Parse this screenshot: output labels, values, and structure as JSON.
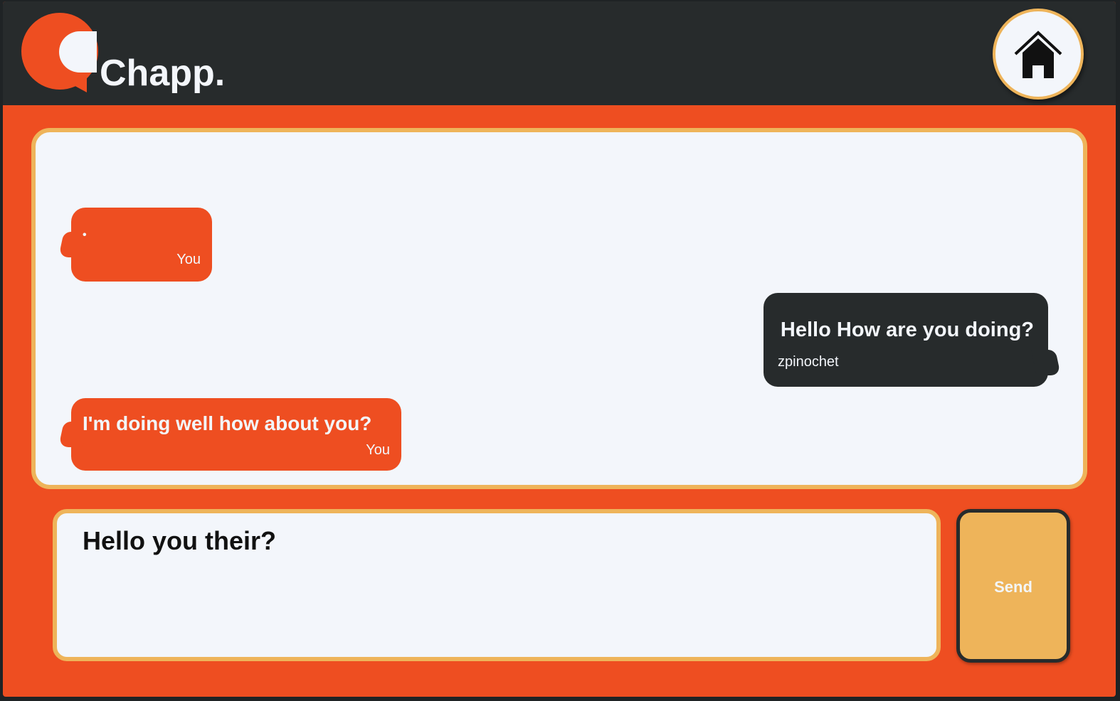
{
  "header": {
    "brand": "Chapp.",
    "logo_icon": "speech-bubble-logo-icon",
    "home_icon": "home-icon"
  },
  "messages": [
    {
      "text": "•",
      "sender": "You",
      "side": "mine"
    },
    {
      "text": "Hello How are you doing?",
      "sender": "zpinochet",
      "side": "theirs"
    },
    {
      "text": "I'm doing well how about you?",
      "sender": "You",
      "side": "mine"
    }
  ],
  "composer": {
    "value": "Hello you their?",
    "send_label": "Send"
  },
  "colors": {
    "accent": "#ee4e21",
    "dark": "#272b2c",
    "gold": "#eeb45a",
    "light": "#f3f6fb"
  }
}
